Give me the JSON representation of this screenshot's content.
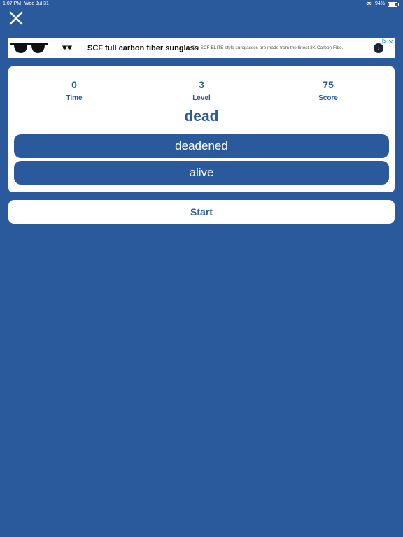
{
  "status_bar": {
    "time": "1:07 PM",
    "date": "Wed Jul 31",
    "battery_text": "94%",
    "battery_level": 0.94,
    "wifi_icon": "wifi-icon",
    "battery_icon": "battery-icon"
  },
  "close_icon": "close-icon",
  "ad": {
    "title": "SCF full carbon fiber sunglass",
    "description": "Our SCF ELITE style sunglasses are made from the finest 3K Carbon Fibe.",
    "arrow_icon": "chevron-right-icon",
    "adchoices_icon": "adchoices-icon",
    "close_icon": "close-icon"
  },
  "stats": {
    "time": {
      "value": "0",
      "label": "Time"
    },
    "level": {
      "value": "3",
      "label": "Level"
    },
    "score": {
      "value": "75",
      "label": "Score"
    }
  },
  "question": {
    "word": "dead",
    "answers": [
      "deadened",
      "alive"
    ]
  },
  "start_label": "Start",
  "colors": {
    "background": "#2b5a9c",
    "card": "#ffffff",
    "accent": "#2b5a9c"
  }
}
